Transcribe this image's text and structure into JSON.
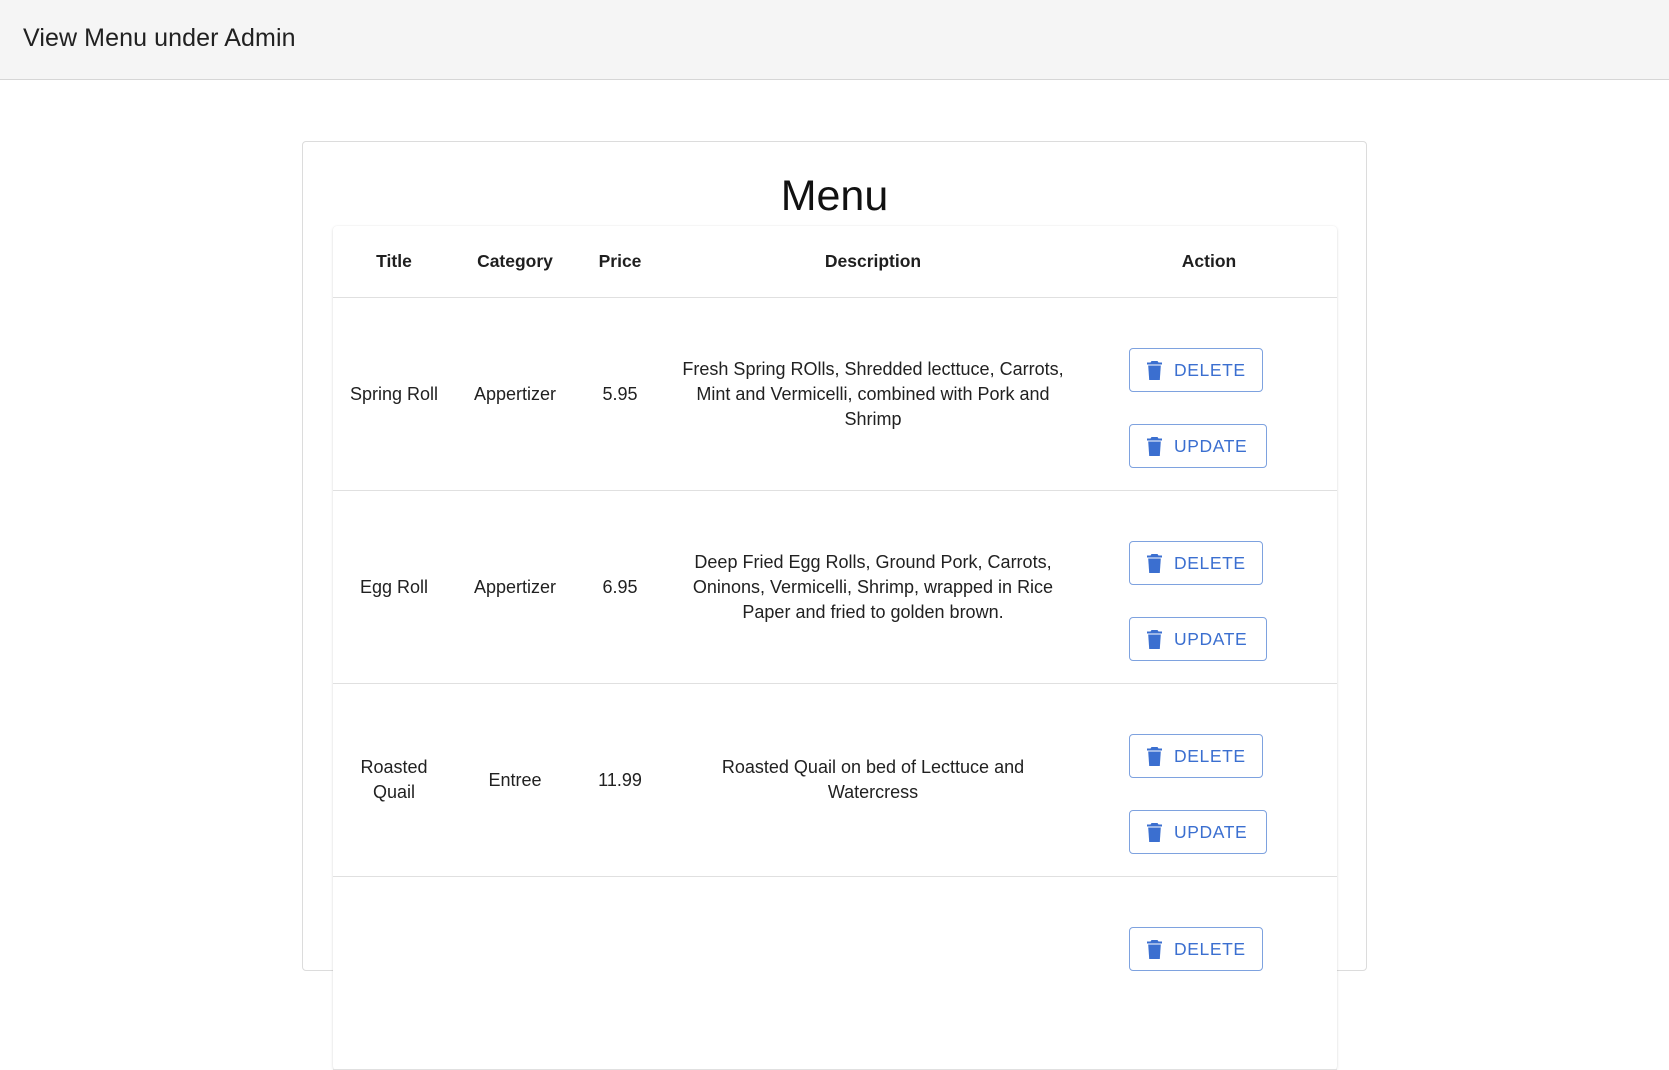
{
  "appbar": {
    "title": "View Menu under Admin"
  },
  "menu": {
    "title": "Menu",
    "columns": [
      "Title",
      "Category",
      "Price",
      "Description",
      "Action"
    ],
    "delete_label": "DELETE",
    "update_label": "UPDATE",
    "rows": [
      {
        "title": "Spring Roll",
        "category": "Appertizer",
        "price": "5.95",
        "description": "Fresh Spring ROlls, Shredded lecttuce, Carrots, Mint and Vermicelli, combined with Pork and Shrimp"
      },
      {
        "title": "Egg Roll",
        "category": "Appertizer",
        "price": "6.95",
        "description": "Deep Fried Egg Rolls, Ground Pork, Carrots, Oninons, Vermicelli, Shrimp, wrapped in Rice Paper and fried to golden brown."
      },
      {
        "title": "Roasted Quail",
        "category": "Entree",
        "price": "11.99",
        "description": "Roasted Quail on bed of Lecttuce and Watercress"
      },
      {
        "title": "",
        "category": "",
        "price": "",
        "description": ""
      }
    ]
  },
  "colors": {
    "appbar_bg": "#f5f5f5",
    "button_text": "#3b6fd0",
    "button_border": "#7ea2df",
    "text": "#212121"
  },
  "icons": {
    "delete": "trash-icon",
    "update": "trash-icon"
  }
}
